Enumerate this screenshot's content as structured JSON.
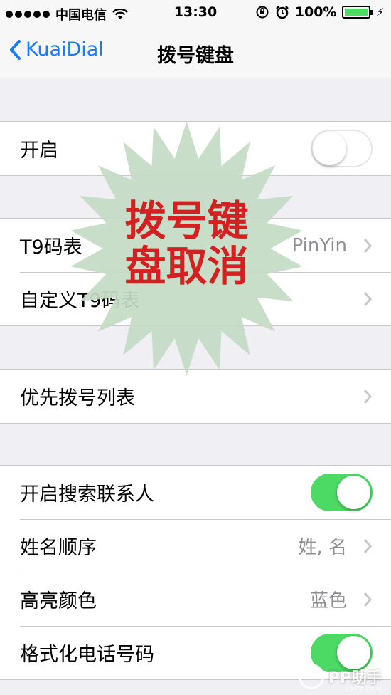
{
  "status_bar": {
    "carrier": "中国电信",
    "time": "13:30",
    "battery": "100%",
    "battery_level": 1.0
  },
  "nav": {
    "back_label": "KuaiDial",
    "title": "拨号键盘"
  },
  "groups": [
    {
      "rows": [
        {
          "label": "开启",
          "toggle": false
        }
      ]
    },
    {
      "rows": [
        {
          "label": "T9码表",
          "value": "PinYin",
          "chevron": true
        },
        {
          "label": "自定义T9码表",
          "chevron": true
        }
      ]
    },
    {
      "rows": [
        {
          "label": "优先拨号列表",
          "chevron": true
        }
      ]
    },
    {
      "rows": [
        {
          "label": "开启搜索联系人",
          "toggle": true
        },
        {
          "label": "姓名顺序",
          "value": "姓, 名",
          "chevron": true
        },
        {
          "label": "高亮颜色",
          "value": "蓝色",
          "chevron": true
        },
        {
          "label": "格式化电话号码",
          "toggle": true
        }
      ]
    }
  ],
  "overlay": {
    "line1": "拨号键",
    "line2": "盘取消"
  },
  "watermark": {
    "text": "PP助手",
    "sub": "25PP.COM"
  },
  "colors": {
    "accent": "#1a7cf5",
    "toggle_on": "#4cd964",
    "stamp_text": "#d42020",
    "stamp_fill": "#c5dcc5"
  }
}
